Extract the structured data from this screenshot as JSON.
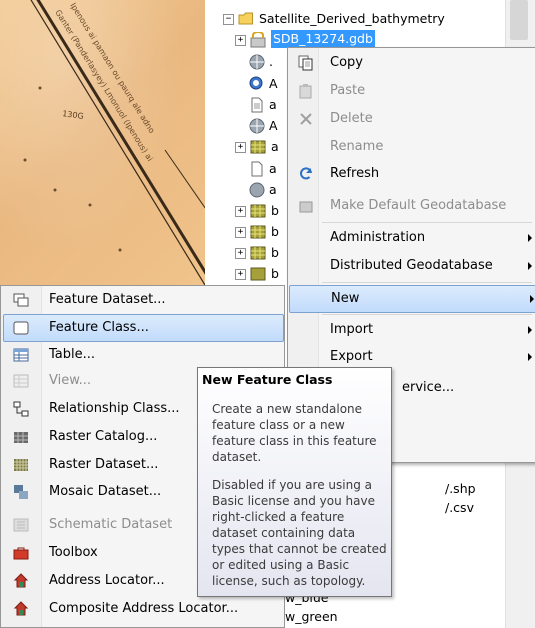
{
  "map_labels": [
    "Ganter (Panderlasyey) Lmonuol (Ipenous) ai",
    "Ipenous ai pamaon ou paurq ale adno",
    "130G"
  ],
  "tree": {
    "root_label": "Satellite_Derived_bathymetry",
    "gdb_label": "SDB_13274.gdb",
    "partial_labels": [
      ".",
      "A",
      "a",
      "A",
      "a",
      "a",
      "a",
      "b",
      "b",
      "b",
      "b"
    ]
  },
  "context_menu": {
    "items": [
      {
        "label": "Copy",
        "icon": "copy-icon",
        "enabled": true
      },
      {
        "label": "Paste",
        "icon": "paste-icon",
        "enabled": false
      },
      {
        "label": "Delete",
        "icon": "delete-icon",
        "enabled": false
      },
      {
        "label": "Rename",
        "icon": "",
        "enabled": false
      },
      {
        "label": "Refresh",
        "icon": "refresh-icon",
        "enabled": true
      },
      {
        "label": "Make Default Geodatabase",
        "icon": "geodatabase-icon",
        "enabled": false
      },
      {
        "label": "Administration",
        "icon": "",
        "enabled": true,
        "submenu": true
      },
      {
        "label": "Distributed Geodatabase",
        "icon": "",
        "enabled": true,
        "submenu": true
      },
      {
        "label": "New",
        "icon": "",
        "enabled": true,
        "submenu": true
      },
      {
        "label": "Import",
        "icon": "",
        "enabled": true,
        "submenu": true
      },
      {
        "label": "Export",
        "icon": "",
        "enabled": true,
        "submenu": true
      }
    ],
    "partial_service": "ervice..."
  },
  "submenu": {
    "items": [
      {
        "label": "Feature Dataset...",
        "icon": "feature-dataset-icon",
        "enabled": true
      },
      {
        "label": "Feature Class...",
        "icon": "feature-class-icon",
        "enabled": true
      },
      {
        "label": "Table...",
        "icon": "table-icon",
        "enabled": true
      },
      {
        "label": "View...",
        "icon": "view-icon",
        "enabled": false
      },
      {
        "label": "Relationship Class...",
        "icon": "relationship-class-icon",
        "enabled": true
      },
      {
        "label": "Raster Catalog...",
        "icon": "raster-catalog-icon",
        "enabled": true
      },
      {
        "label": "Raster Dataset...",
        "icon": "raster-dataset-icon",
        "enabled": true
      },
      {
        "label": "Mosaic Dataset...",
        "icon": "mosaic-dataset-icon",
        "enabled": true
      },
      {
        "label": "Schematic Dataset",
        "icon": "schematic-dataset-icon",
        "enabled": false
      },
      {
        "label": "Toolbox",
        "icon": "toolbox-icon",
        "enabled": true
      },
      {
        "label": "Address Locator...",
        "icon": "address-locator-icon",
        "enabled": true
      },
      {
        "label": "Composite Address Locator...",
        "icon": "composite-address-locator-icon",
        "enabled": true
      }
    ]
  },
  "tooltip": {
    "title": "New Feature Class",
    "paragraph1": "Create a new standalone feature class or a new feature class in this feature dataset.",
    "paragraph2": "Disabled if you are using a Basic license and you have right-clicked a feature dataset containing data types that cannot be created or edited using a Basic license, such as topology."
  },
  "behind_text": {
    "shp": "/.shp",
    "csv": "/.csv",
    "blue": "w_blue",
    "green": "w_green"
  },
  "colors": {
    "highlight_border": "#7da2ce",
    "highlight_fill": "#c1dbfc",
    "selection": "#3399ff",
    "disabled_text": "#8d8d8d"
  }
}
